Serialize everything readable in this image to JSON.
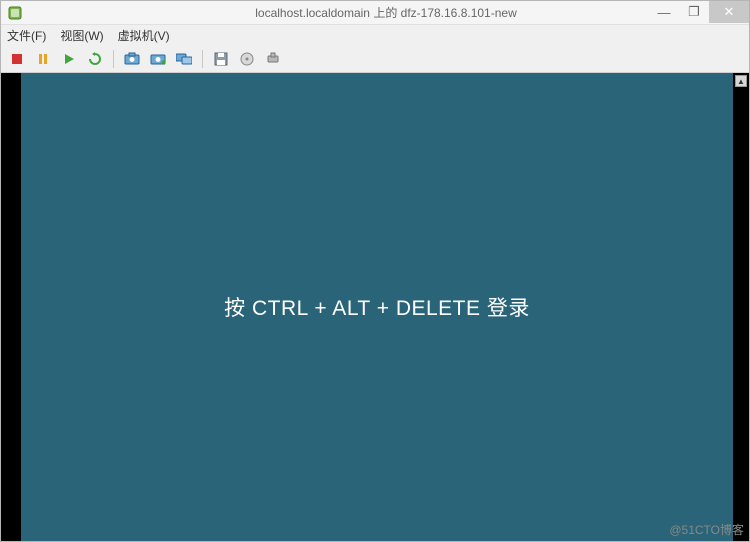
{
  "titlebar": {
    "title": "localhost.localdomain 上的 dfz-178.16.8.101-new"
  },
  "window_controls": {
    "minimize": "—",
    "maximize": "❐",
    "close": "✕"
  },
  "menubar": {
    "file": "文件(F)",
    "view": "视图(W)",
    "vm": "虚拟机(V)"
  },
  "toolbar_icons": {
    "stop": "stop",
    "pause": "pause",
    "play": "play",
    "restart": "restart",
    "snapshot_take": "snapshot-take",
    "snapshot_revert": "snapshot-revert",
    "snapshot_manage": "snapshot-manage",
    "floppy": "floppy",
    "cdrom": "cdrom",
    "network": "network"
  },
  "console": {
    "login_message": "按 CTRL + ALT + DELETE 登录"
  },
  "watermark": "@51CTO博客"
}
